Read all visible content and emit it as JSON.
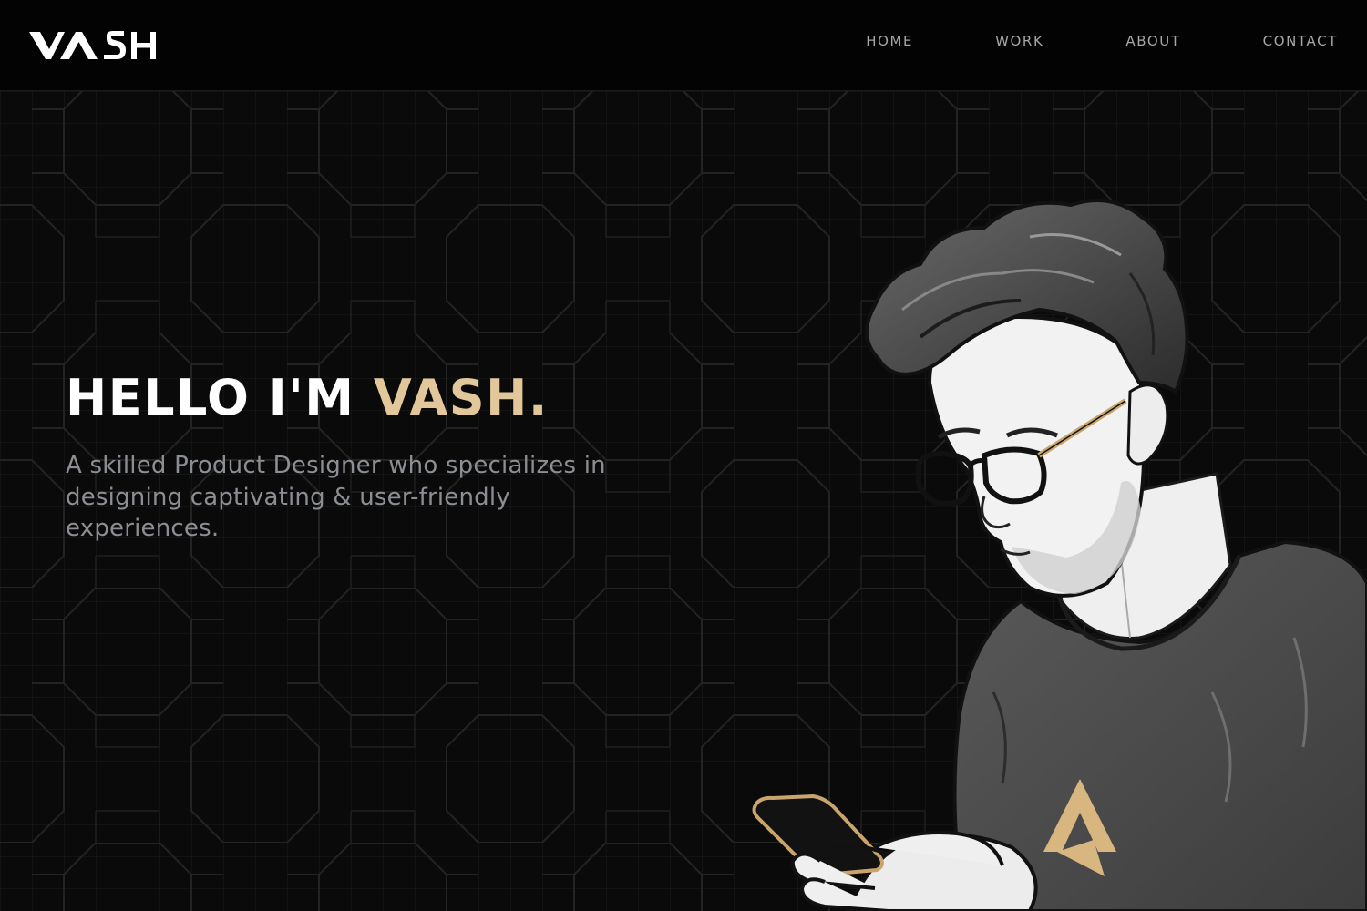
{
  "header": {
    "logo_text": "VASH",
    "nav": {
      "home": "HOME",
      "work": "WORK",
      "about": "ABOUT",
      "contact": "CONTACT"
    }
  },
  "hero": {
    "title_prefix": "HELLO I'M ",
    "title_accent": "VASH.",
    "subtitle": "A skilled Product Designer who specializes in designing captivating & user-friendly experiences."
  },
  "colors": {
    "background": "#0a0a0a",
    "header_background": "#030303",
    "accent": "#e2c79a",
    "heading": "#ffffff",
    "body_text": "#8b8e93",
    "nav_text": "#a6a6a6"
  },
  "icons": {
    "logo": "vash-logo",
    "shirt_emblem": "triangle-logo-icon"
  }
}
